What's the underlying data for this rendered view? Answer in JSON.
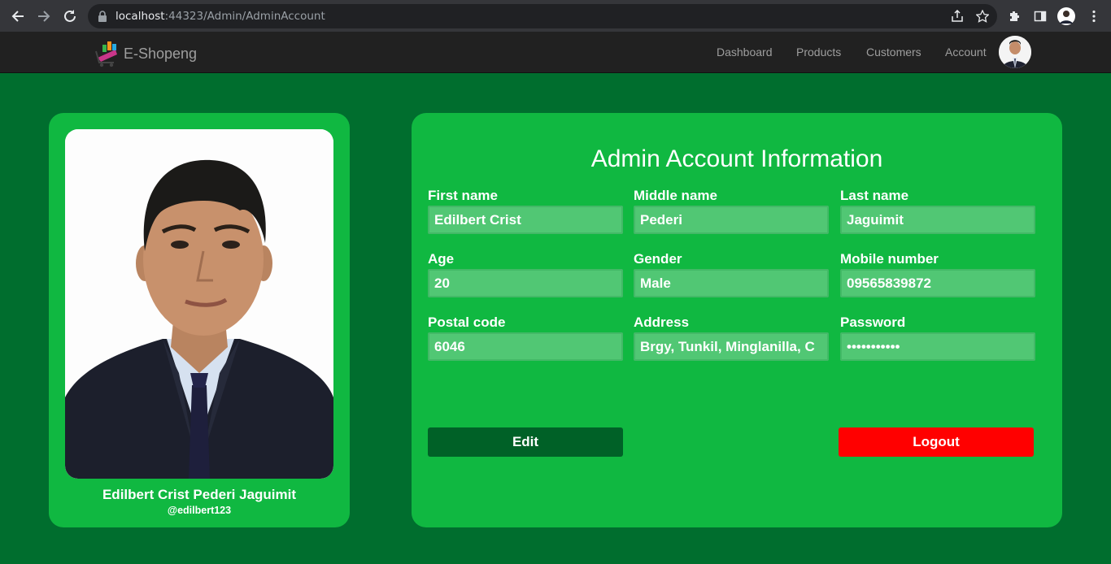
{
  "browser": {
    "url_host": "localhost",
    "url_rest": ":44323/Admin/AdminAccount"
  },
  "navbar": {
    "brand": "E-Shopeng",
    "links": [
      "Dashboard",
      "Products",
      "Customers",
      "Account"
    ]
  },
  "profile": {
    "full_name": "Edilbert Crist Pederi Jaguimit",
    "handle": "@edilbert123"
  },
  "account": {
    "title": "Admin Account Information",
    "fields": [
      {
        "label": "First name",
        "value": "Edilbert Crist"
      },
      {
        "label": "Middle name",
        "value": "Pederi"
      },
      {
        "label": "Last name",
        "value": "Jaguimit"
      },
      {
        "label": "Age",
        "value": "20"
      },
      {
        "label": "Gender",
        "value": "Male"
      },
      {
        "label": "Mobile number",
        "value": "09565839872"
      },
      {
        "label": "Postal code",
        "value": "6046"
      },
      {
        "label": "Address",
        "value": "Brgy, Tunkil, Minglanilla, C"
      },
      {
        "label": "Password",
        "value": "•••••••••••"
      }
    ],
    "edit_label": "Edit",
    "logout_label": "Logout"
  },
  "colors": {
    "page_bg": "#006e2e",
    "card_bg": "#10b841",
    "input_bg": "#51c774",
    "edit_button": "#006127",
    "logout_button": "#ff0000",
    "navbar_bg": "#212121"
  }
}
